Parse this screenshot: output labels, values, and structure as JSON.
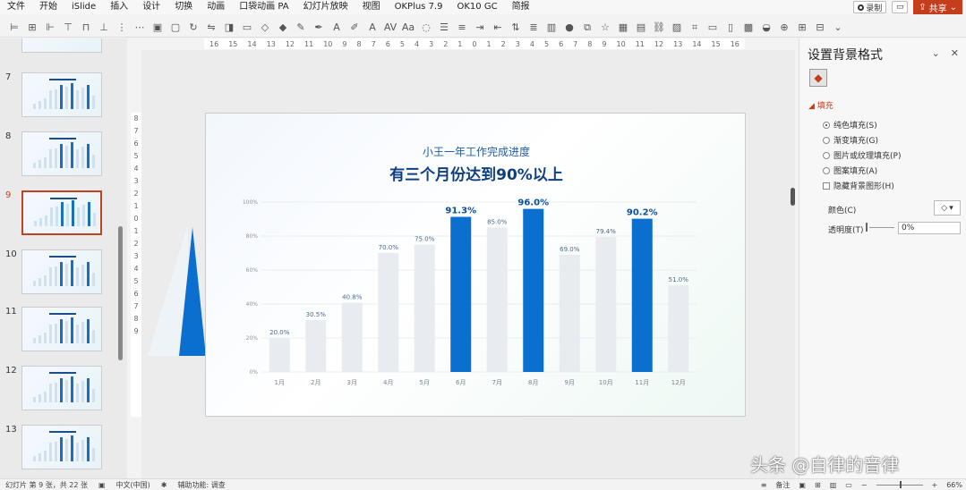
{
  "menu": [
    "文件",
    "开始",
    "iSlide",
    "插入",
    "设计",
    "切换",
    "动画",
    "口袋动画 PA",
    "幻灯片放映",
    "视图",
    "OKPlus 7.9",
    "OK10 GC",
    "简报"
  ],
  "menu_right": {
    "record_label": "录制",
    "share_label": "共享"
  },
  "slides_panel": {
    "numbers": [
      "7",
      "8",
      "9",
      "10",
      "11",
      "12",
      "13"
    ],
    "active": "9"
  },
  "ruler": {
    "h_ticks": [
      "16",
      "15",
      "14",
      "13",
      "12",
      "11",
      "10",
      "9",
      "8",
      "7",
      "6",
      "5",
      "4",
      "3",
      "2",
      "1",
      "0",
      "1",
      "2",
      "3",
      "4",
      "5",
      "6",
      "7",
      "8",
      "9",
      "10",
      "11",
      "12",
      "13",
      "14",
      "15",
      "16"
    ],
    "v_ticks": [
      "8",
      "7",
      "6",
      "5",
      "4",
      "3",
      "2",
      "1",
      "0",
      "1",
      "2",
      "3",
      "4",
      "5",
      "6",
      "7",
      "8",
      "9"
    ]
  },
  "slide": {
    "subtitle": "小王一年工作完成进度",
    "title": "有三个月份达到90%以上"
  },
  "chart_data": {
    "type": "bar",
    "categories": [
      "1月",
      "2月",
      "3月",
      "4月",
      "5月",
      "6月",
      "7月",
      "8月",
      "9月",
      "10月",
      "11月",
      "12月"
    ],
    "values": [
      20.0,
      30.5,
      40.8,
      70.0,
      75.0,
      91.3,
      85.0,
      96.0,
      69.0,
      79.4,
      90.2,
      51.0
    ],
    "labels": [
      "20.0%",
      "30.5%",
      "40.8%",
      "70.0%",
      "75.0%",
      "91.3%",
      "85.0%",
      "96.0%",
      "69.0%",
      "79.4%",
      "90.2%",
      "51.0%"
    ],
    "highlighted": [
      "6月",
      "8月",
      "11月"
    ],
    "y_ticks": [
      "0%",
      "20%",
      "40%",
      "60%",
      "80%",
      "100%"
    ],
    "ylim": [
      0,
      100
    ],
    "highlight_color": "#0b6fd0",
    "normal_color": "#e8ecf0",
    "grid": true
  },
  "format_pane": {
    "title": "设置背景格式",
    "section": "填充",
    "options": [
      {
        "label": "纯色填充(S)",
        "selected": true
      },
      {
        "label": "渐变填充(G)",
        "selected": false
      },
      {
        "label": "图片或纹理填充(P)",
        "selected": false
      },
      {
        "label": "图案填充(A)",
        "selected": false
      }
    ],
    "hide_bg_label": "隐藏背景图形(H)",
    "color_label": "颜色(C)",
    "transparency_label": "透明度(T)",
    "transparency_value": "0%"
  },
  "status": {
    "slide_info": "幻灯片 第 9 张，共 22 张",
    "language": "中文(中国)",
    "accessibility": "辅助功能: 调查",
    "notes": "备注",
    "zoom": "66%"
  },
  "watermark": "头条 @自律的音律"
}
